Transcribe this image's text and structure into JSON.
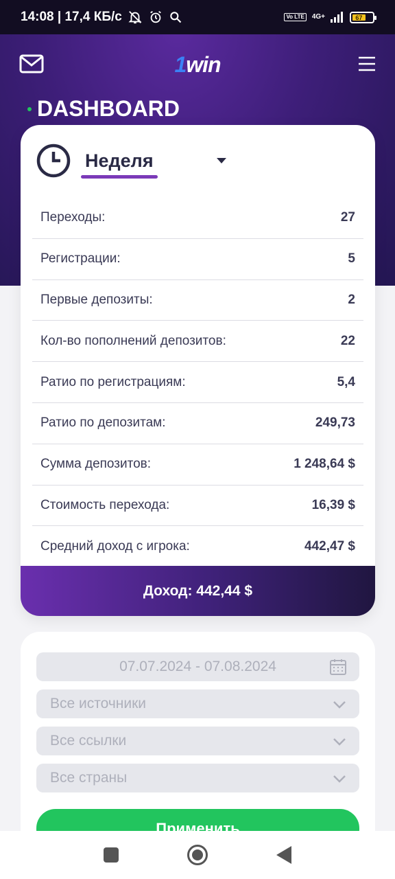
{
  "status_bar": {
    "time_speed": "14:08 | 17,4 КБ/с",
    "volte": "Vo LTE",
    "network": "4G+",
    "battery": "67",
    "icons": [
      "mute-icon",
      "alarm-icon",
      "search-icon",
      "signal-icon",
      "battery-icon"
    ]
  },
  "header": {
    "logo_one": "1",
    "logo_rest": "win",
    "icons": [
      "mail-icon",
      "menu-icon"
    ]
  },
  "page_title": "DASHBOARD",
  "period": {
    "label": "Неделя"
  },
  "stats": [
    {
      "label": "Переходы:",
      "value": "27"
    },
    {
      "label": "Регистрации:",
      "value": "5"
    },
    {
      "label": "Первые депозиты:",
      "value": "2"
    },
    {
      "label": "Кол-во пополнений депозитов:",
      "value": "22"
    },
    {
      "label": "Ратио по регистрациям:",
      "value": "5,4"
    },
    {
      "label": "Ратио по депозитам:",
      "value": "249,73"
    },
    {
      "label": "Сумма депозитов:",
      "value": "1 248,64 $"
    },
    {
      "label": "Стоимость перехода:",
      "value": "16,39 $"
    },
    {
      "label": "Средний доход с игрока:",
      "value": "442,47 $"
    }
  ],
  "income": "Доход: 442,44 $",
  "filters": {
    "date_range": "07.07.2024 - 07.08.2024",
    "sources": "Все источники",
    "links": "Все ссылки",
    "countries": "Все страны",
    "apply": "Применить"
  },
  "colors": {
    "accent_purple": "#6a2fae",
    "apply_green": "#22c55e",
    "logo_blue": "#3b82f6"
  }
}
